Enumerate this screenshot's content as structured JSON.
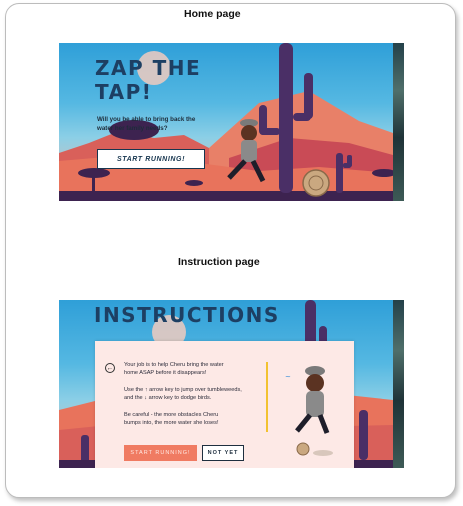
{
  "captions": {
    "home": "Home page",
    "instruction": "Instruction page"
  },
  "home": {
    "title_line1": "ZAP THE",
    "title_line2": "TAP!",
    "subtitle_line1": "Will you be able to bring back the",
    "subtitle_line2": "water her family needs?",
    "start_button": "START RUNNING!"
  },
  "instructions": {
    "title": "INSTRUCTIONS",
    "para1_line1": "Your job is to help Cheru bring the water",
    "para1_line2": "home ASAP before it disappears!",
    "para2_line1": "Use the ↑ arrow key to jump over tumbleweeds,",
    "para2_line2": "and the ↓ arrow key to dodge birds.",
    "para3_line1": "Be careful - the more obstacles Cheru",
    "para3_line2": "bumps into, the more water she loses!",
    "start_button": "START RUNNING!",
    "not_yet_button": "NOT YET",
    "back_icon": "back-arrow-icon"
  },
  "colors": {
    "title": "#1d3f63",
    "sky": "#2f9fd8",
    "ground": "#e8735c",
    "cactus": "#4a2f66",
    "card": "#fde9e6",
    "accent_button": "#f07b62",
    "divider": "#f2c230"
  }
}
